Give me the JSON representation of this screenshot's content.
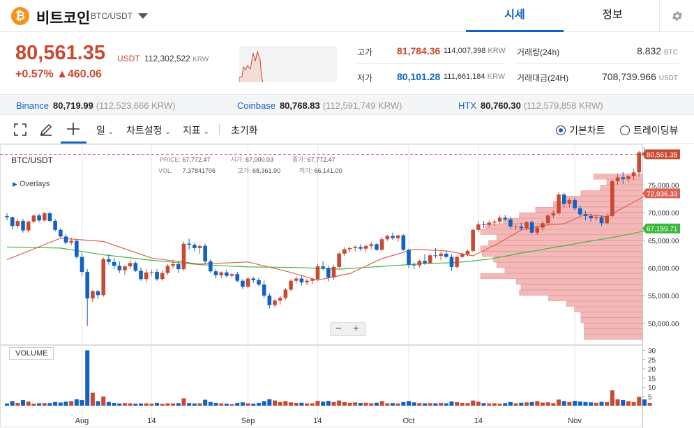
{
  "header": {
    "logo_glyph": "₿",
    "coin_name": "비트코인",
    "pair": "BTC/USDT",
    "tabs": [
      {
        "label": "시세",
        "active": true
      },
      {
        "label": "정보",
        "active": false
      }
    ]
  },
  "price": {
    "last": "80,561.35",
    "unit": "USDT",
    "krw": "112,302,522",
    "krw_unit": "KRW",
    "change_pct": "+0.57%",
    "change_abs": "▲460.06",
    "high_label": "고가",
    "high": "81,784.36",
    "high_krw": "114,007,398",
    "high_krw_unit": "KRW",
    "low_label": "저가",
    "low": "80,101.28",
    "low_krw": "111,661,184",
    "low_krw_unit": "KRW",
    "vol_label": "거래량(24h)",
    "vol": "8.832",
    "vol_unit": "BTC",
    "amt_label": "거래대금(24H)",
    "amt": "708,739.966",
    "amt_unit": "USDT"
  },
  "exchanges": [
    {
      "name": "Binance",
      "price": "80,719.99",
      "krw": "(112,523,666 KRW)"
    },
    {
      "name": "Coinbase",
      "price": "80,768.83",
      "krw": "(112,591,749 KRW)"
    },
    {
      "name": "HTX",
      "price": "80,760.30",
      "krw": "(112,579,858 KRW)"
    }
  ],
  "toolbar": {
    "interval": "일",
    "chart_settings": "차트설정",
    "indicators": "지표",
    "reset": "초기화",
    "view_basic": "기본차트",
    "view_tv": "트레이딩뷰"
  },
  "legend": {
    "symbol": "BTC/USDT",
    "overlays": "Overlays",
    "price_label": "PRICE:",
    "price": "67,772.47",
    "open_label": "시가:",
    "open": "67,000.03",
    "close_label": "종가:",
    "close": "67,772.47",
    "vol_label": "VOL:",
    "vol": "7.37841706",
    "high_label": "고가:",
    "high": "68,361.90",
    "low_label": "저가:",
    "low": "66,141.00"
  },
  "volume_label": "VOLUME",
  "zoom": {
    "minus": "−",
    "plus": "+"
  },
  "colors": {
    "up": "#c84a31",
    "down": "#1261c4",
    "ma_short": "#e06050",
    "ma_long": "#3cb83c",
    "accent": "#1261c4"
  },
  "badges": {
    "last": "80,561.35",
    "ma_short": "72,936.33",
    "ma_long": "67,159.71"
  },
  "chart_data": {
    "type": "candlestick",
    "price_ticks": [
      50000,
      55000,
      60000,
      65000,
      70000,
      75000
    ],
    "price_tick_labels": [
      "50,000.00",
      "55,000.00",
      "60,000.00",
      "65,000.00",
      "70,000.00",
      "75,000.00"
    ],
    "volume_ticks": [
      5,
      10,
      15,
      20,
      25,
      30
    ],
    "x_ticks": [
      {
        "label": "Aug",
        "index": 14
      },
      {
        "label": "14",
        "index": 27
      },
      {
        "label": "Sep",
        "index": 45
      },
      {
        "label": "14",
        "index": 58
      },
      {
        "label": "Oct",
        "index": 75
      },
      {
        "label": "14",
        "index": 88
      },
      {
        "label": "Nov",
        "index": 106
      }
    ],
    "candles": [
      [
        69400,
        69900,
        68600,
        69200,
        1.2
      ],
      [
        69200,
        69300,
        67000,
        67600,
        2.5
      ],
      [
        67600,
        68800,
        67200,
        68500,
        1.5
      ],
      [
        68500,
        68900,
        66400,
        66800,
        3
      ],
      [
        66800,
        68600,
        66400,
        68400,
        2.2
      ],
      [
        68400,
        69700,
        68100,
        69500,
        1.1
      ],
      [
        69500,
        69800,
        68300,
        68600,
        1.3
      ],
      [
        68600,
        70100,
        68400,
        69900,
        1.4
      ],
      [
        69900,
        70200,
        68300,
        68500,
        1.4
      ],
      [
        68500,
        68900,
        66600,
        66900,
        2
      ],
      [
        66900,
        67200,
        65500,
        65700,
        1.7
      ],
      [
        65700,
        66100,
        64200,
        64600,
        2.2
      ],
      [
        64600,
        65500,
        64100,
        64900,
        2.5
      ],
      [
        64900,
        65100,
        61700,
        62000,
        3.5
      ],
      [
        62000,
        62700,
        58500,
        59300,
        3
      ],
      [
        59300,
        59800,
        49500,
        54500,
        30
      ],
      [
        54500,
        56000,
        53800,
        55800,
        7
      ],
      [
        55800,
        56100,
        54400,
        55100,
        2.5
      ],
      [
        55100,
        61900,
        54800,
        61600,
        5
      ],
      [
        61600,
        62500,
        60600,
        61100,
        2
      ],
      [
        61100,
        61800,
        59800,
        60400,
        1.5
      ],
      [
        60400,
        61200,
        59100,
        59600,
        1.2
      ],
      [
        59600,
        60500,
        58700,
        60300,
        1.4
      ],
      [
        60300,
        61500,
        59800,
        60900,
        1.3
      ],
      [
        60900,
        61200,
        59300,
        59500,
        1.1
      ],
      [
        59500,
        60100,
        57700,
        58000,
        1.2
      ],
      [
        58000,
        59800,
        57400,
        59200,
        1.3
      ],
      [
        59200,
        59700,
        58600,
        59300,
        1.1
      ],
      [
        59300,
        59800,
        57700,
        58000,
        1.5
      ],
      [
        58000,
        59600,
        57700,
        59100,
        1
      ],
      [
        59100,
        60700,
        58700,
        60400,
        1.3
      ],
      [
        60400,
        61500,
        59900,
        60700,
        1.2
      ],
      [
        60700,
        61300,
        59100,
        59800,
        1.4
      ],
      [
        59800,
        64800,
        59500,
        64400,
        4
      ],
      [
        64400,
        65300,
        63300,
        64200,
        1.4
      ],
      [
        64200,
        64600,
        63000,
        63600,
        1.2
      ],
      [
        63600,
        64200,
        62600,
        64000,
        1.3
      ],
      [
        64000,
        64400,
        60800,
        61200,
        3.2
      ],
      [
        61200,
        61600,
        59100,
        59400,
        2
      ],
      [
        59400,
        59800,
        58100,
        58700,
        1.5
      ],
      [
        58700,
        59400,
        58200,
        59200,
        1.2
      ],
      [
        59200,
        59700,
        58300,
        58600,
        1.1
      ],
      [
        58600,
        59100,
        58300,
        58900,
        0.8
      ],
      [
        58900,
        59300,
        57400,
        57700,
        1.5
      ],
      [
        57700,
        58000,
        56200,
        56600,
        1.8
      ],
      [
        56600,
        58400,
        56300,
        58100,
        1.3
      ],
      [
        58100,
        58400,
        57300,
        57800,
        1.1
      ],
      [
        57800,
        58200,
        56700,
        57000,
        1.5
      ],
      [
        57000,
        57700,
        54600,
        55000,
        2.5
      ],
      [
        55000,
        55500,
        52700,
        53300,
        3.5
      ],
      [
        53300,
        54400,
        52900,
        54100,
        2.8
      ],
      [
        54100,
        54900,
        53400,
        54600,
        2
      ],
      [
        54600,
        56400,
        54200,
        56100,
        2.5
      ],
      [
        56100,
        58000,
        55800,
        57700,
        1.8
      ],
      [
        57700,
        58500,
        57200,
        58100,
        1.5
      ],
      [
        58100,
        58700,
        56800,
        57400,
        1.6
      ],
      [
        57400,
        58100,
        56900,
        57700,
        1.2
      ],
      [
        57700,
        58200,
        57100,
        58000,
        1.3
      ],
      [
        58000,
        60800,
        57700,
        60300,
        2.6
      ],
      [
        60300,
        61200,
        59600,
        60000,
        2.2
      ],
      [
        60000,
        60400,
        57600,
        58300,
        2.6
      ],
      [
        58300,
        60600,
        57900,
        60200,
        2
      ],
      [
        60200,
        62900,
        59900,
        62600,
        2.8
      ],
      [
        62600,
        63800,
        62200,
        63400,
        2
      ],
      [
        63400,
        63900,
        62900,
        63600,
        1.6
      ],
      [
        63600,
        64100,
        63000,
        63800,
        1.8
      ],
      [
        63800,
        64300,
        63100,
        63500,
        1.5
      ],
      [
        63500,
        64200,
        62800,
        64000,
        1.6
      ],
      [
        64000,
        64700,
        63400,
        64300,
        1.3
      ],
      [
        64300,
        64500,
        63100,
        63300,
        1.6
      ],
      [
        63300,
        65600,
        63000,
        65200,
        2.5
      ],
      [
        65200,
        66000,
        64900,
        65800,
        1.3
      ],
      [
        65800,
        66400,
        65100,
        65400,
        1.4
      ],
      [
        65400,
        66000,
        64700,
        65900,
        1.2
      ],
      [
        65900,
        66100,
        63100,
        63300,
        2
      ],
      [
        63300,
        63500,
        60000,
        60600,
        2.5
      ],
      [
        60600,
        61000,
        59800,
        60500,
        1.8
      ],
      [
        60500,
        61500,
        60100,
        61300,
        1.4
      ],
      [
        61300,
        62500,
        60600,
        60900,
        1.3
      ],
      [
        60900,
        62600,
        60700,
        62300,
        1.4
      ],
      [
        62300,
        63600,
        61800,
        62200,
        1.3
      ],
      [
        62200,
        63000,
        61400,
        62600,
        1.5
      ],
      [
        62600,
        63100,
        61700,
        62000,
        1.3
      ],
      [
        62000,
        62500,
        59500,
        60200,
        2.3
      ],
      [
        60200,
        62300,
        59900,
        62000,
        1.9
      ],
      [
        62000,
        62800,
        61800,
        62500,
        1.5
      ],
      [
        62500,
        63400,
        62100,
        63100,
        1.4
      ],
      [
        63100,
        67100,
        62900,
        66900,
        2.8
      ],
      [
        66900,
        68400,
        66500,
        67900,
        2.2
      ],
      [
        67900,
        68500,
        67200,
        67800,
        1.4
      ],
      [
        67800,
        68600,
        67300,
        68200,
        1.2
      ],
      [
        68200,
        68800,
        67600,
        68400,
        1.3
      ],
      [
        68400,
        69500,
        68000,
        69100,
        1.1
      ],
      [
        69100,
        69600,
        68500,
        68800,
        1.4
      ],
      [
        68800,
        69300,
        67100,
        67500,
        2
      ],
      [
        67500,
        68000,
        66900,
        67500,
        1.3
      ],
      [
        67500,
        68200,
        66800,
        67200,
        1.6
      ],
      [
        67200,
        68500,
        66800,
        68300,
        1.8
      ],
      [
        68300,
        68600,
        66200,
        66400,
        2
      ],
      [
        66400,
        67600,
        66000,
        67300,
        2.5
      ],
      [
        67300,
        68500,
        66700,
        68100,
        1.7
      ],
      [
        68100,
        69800,
        67800,
        69500,
        1.8
      ],
      [
        69500,
        70400,
        69000,
        69900,
        1.4
      ],
      [
        69900,
        73700,
        69600,
        73300,
        3.3
      ],
      [
        73300,
        73600,
        71000,
        71600,
        2.5
      ],
      [
        71600,
        72600,
        71000,
        72300,
        2
      ],
      [
        72300,
        72700,
        70400,
        70800,
        2.6
      ],
      [
        70800,
        71300,
        69400,
        69700,
        2.3
      ],
      [
        69700,
        70300,
        68600,
        69400,
        2
      ],
      [
        69400,
        69800,
        68400,
        69000,
        1.8
      ],
      [
        69000,
        69700,
        68500,
        69200,
        1.6
      ],
      [
        69200,
        69500,
        67600,
        68100,
        2.1
      ],
      [
        68100,
        69800,
        67900,
        69400,
        1.9
      ],
      [
        69400,
        76000,
        69100,
        75700,
        8.3
      ],
      [
        75700,
        77000,
        75000,
        76400,
        3.5
      ],
      [
        76400,
        77400,
        75200,
        76100,
        3
      ],
      [
        76100,
        76900,
        75500,
        76600,
        2.4
      ],
      [
        76600,
        77900,
        75900,
        77300,
        2
      ],
      [
        77300,
        81200,
        76500,
        80900,
        4.8
      ],
      [
        80900,
        81800,
        79800,
        80400,
        3.4
      ],
      [
        80400,
        81200,
        80000,
        80561.35,
        1.5
      ]
    ],
    "ma_short": [
      [
        0,
        61500
      ],
      [
        10,
        65400
      ],
      [
        18,
        64800
      ],
      [
        27,
        61800
      ],
      [
        36,
        60700
      ],
      [
        45,
        61100
      ],
      [
        53,
        59200
      ],
      [
        58,
        57800
      ],
      [
        64,
        59000
      ],
      [
        70,
        61700
      ],
      [
        76,
        63400
      ],
      [
        82,
        63100
      ],
      [
        87,
        62200
      ],
      [
        92,
        64600
      ],
      [
        96,
        66900
      ],
      [
        100,
        67700
      ],
      [
        104,
        68000
      ],
      [
        108,
        69700
      ],
      [
        112,
        69300
      ],
      [
        116,
        71400
      ],
      [
        119,
        73000
      ],
      [
        121,
        73500
      ]
    ],
    "ma_long": [
      [
        0,
        63800
      ],
      [
        10,
        63600
      ],
      [
        18,
        62400
      ],
      [
        27,
        61400
      ],
      [
        36,
        60600
      ],
      [
        45,
        60200
      ],
      [
        54,
        60100
      ],
      [
        62,
        59800
      ],
      [
        70,
        60300
      ],
      [
        78,
        60800
      ],
      [
        84,
        61000
      ],
      [
        90,
        61600
      ],
      [
        96,
        62700
      ],
      [
        102,
        63700
      ],
      [
        108,
        64700
      ],
      [
        114,
        65700
      ],
      [
        119,
        66700
      ],
      [
        121,
        67160
      ]
    ],
    "volume_profile": [
      {
        "price": 76500,
        "weight": 0.3
      },
      {
        "price": 75500,
        "weight": 0.22
      },
      {
        "price": 74500,
        "weight": 0.26
      },
      {
        "price": 73500,
        "weight": 0.38
      },
      {
        "price": 72500,
        "weight": 0.48
      },
      {
        "price": 71500,
        "weight": 0.55
      },
      {
        "price": 70500,
        "weight": 0.66
      },
      {
        "price": 69500,
        "weight": 0.76
      },
      {
        "price": 68500,
        "weight": 0.86
      },
      {
        "price": 67500,
        "weight": 0.97
      },
      {
        "price": 66500,
        "weight": 1.0
      },
      {
        "price": 65500,
        "weight": 0.9
      },
      {
        "price": 64500,
        "weight": 0.95
      },
      {
        "price": 63500,
        "weight": 1.0
      },
      {
        "price": 62500,
        "weight": 0.99
      },
      {
        "price": 61500,
        "weight": 0.92
      },
      {
        "price": 60500,
        "weight": 0.9
      },
      {
        "price": 59500,
        "weight": 0.85
      },
      {
        "price": 58500,
        "weight": 1.0
      },
      {
        "price": 57500,
        "weight": 0.78
      },
      {
        "price": 56500,
        "weight": 0.75
      },
      {
        "price": 55500,
        "weight": 0.76
      },
      {
        "price": 54500,
        "weight": 0.58
      },
      {
        "price": 53500,
        "weight": 0.47
      },
      {
        "price": 52500,
        "weight": 0.42
      },
      {
        "price": 51500,
        "weight": 0.38
      },
      {
        "price": 50500,
        "weight": 0.38
      },
      {
        "price": 49500,
        "weight": 0.36
      },
      {
        "price": 48500,
        "weight": 0.36
      },
      {
        "price": 47500,
        "weight": 0.36
      }
    ]
  }
}
